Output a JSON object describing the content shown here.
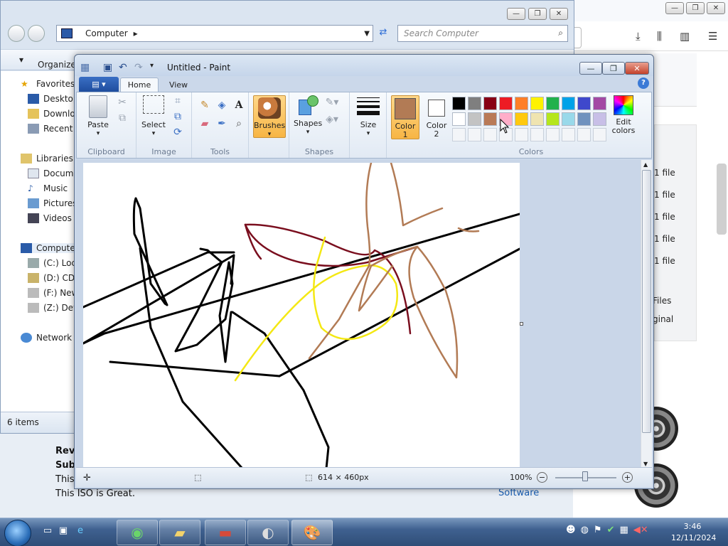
{
  "explorer": {
    "address": "Computer",
    "search_placeholder": "Search Computer",
    "organize": "Organize",
    "nav": {
      "favorites": "Favorites",
      "desktop": "Desktop",
      "downloads": "Downloa",
      "recent": "Recent P",
      "libraries": "Libraries",
      "documents": "Docume",
      "music": "Music",
      "pictures": "Pictures",
      "videos": "Videos",
      "computer": "Computer",
      "drive_c": "(C:) Loca",
      "drive_d": "(D:) CD D",
      "drive_f": "(F:) New",
      "drive_z": "(Z:) Devi",
      "network": "Network"
    },
    "status": "6 items"
  },
  "browser": {
    "file_items": [
      "1 file",
      "1 file",
      "1 file",
      "1 file",
      "1 file"
    ],
    "files_label": "Files",
    "original_label": "ginal",
    "software_link": "Software"
  },
  "page_text": {
    "line1": "Rev",
    "line2": "Sub",
    "line3": "This",
    "line4": "This ISO is Great."
  },
  "paint": {
    "title": "Untitled - Paint",
    "tabs": {
      "home": "Home",
      "view": "View"
    },
    "groups": {
      "clipboard": "Clipboard",
      "image": "Image",
      "tools": "Tools",
      "shapes": "Shapes",
      "colors": "Colors"
    },
    "buttons": {
      "paste": "Paste",
      "select": "Select",
      "brushes": "Brushes",
      "shapes": "Shapes",
      "size": "Size",
      "color1_a": "Color",
      "color1_b": "1",
      "color2_a": "Color",
      "color2_b": "2",
      "edit_colors_a": "Edit",
      "edit_colors_b": "colors"
    },
    "color1": "#b27b55",
    "color2": "#ffffff",
    "palette_row1": [
      "#000000",
      "#7f7f7f",
      "#880015",
      "#ed1c24",
      "#ff7f27",
      "#fff200",
      "#22b14c",
      "#00a2e8",
      "#3f48cc",
      "#a349a4"
    ],
    "palette_row2": [
      "#ffffff",
      "#c3c3c3",
      "#b97a57",
      "#ffaec9",
      "#ffc90e",
      "#efe4b0",
      "#b5e61d",
      "#99d9ea",
      "#7092be",
      "#c8bfe7"
    ],
    "status": {
      "dimensions": "614 × 460px",
      "zoom": "100%"
    }
  },
  "taskbar": {
    "time": "3:46",
    "date": "12/11/2024"
  },
  "colors": {
    "stroke_black": "#000000",
    "stroke_darkred": "#7a0e1e",
    "stroke_yellow": "#f4e814",
    "stroke_brown": "#b27b55"
  }
}
